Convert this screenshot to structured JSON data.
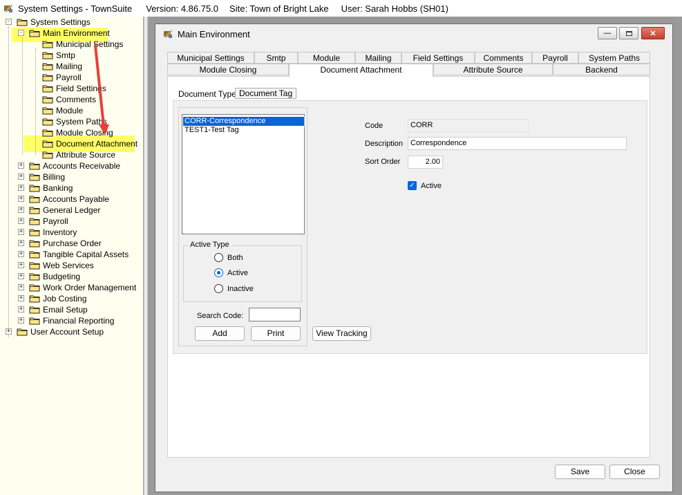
{
  "titlebar": {
    "app_title": "System Settings - TownSuite",
    "version": "Version: 4.86.75.0",
    "site": "Site: Town of Bright Lake",
    "user": "User: Sarah Hobbs (SH01)"
  },
  "tree": {
    "root": "System Settings",
    "main_env": "Main Environment",
    "children": [
      "Municipal Settings",
      "Smtp",
      "Mailing",
      "Payroll",
      "Field Settings",
      "Comments",
      "Module",
      "System Paths",
      "Module Closing",
      "Document Attachment",
      "Attribute Source"
    ],
    "modules": [
      "Accounts Receivable",
      "Billing",
      "Banking",
      "Accounts Payable",
      "General Ledger",
      "Payroll",
      "Inventory",
      "Purchase Order",
      "Tangible Capital Assets",
      "Web Services",
      "Budgeting",
      "Work Order Management",
      "Job Costing",
      "Email Setup",
      "Financial Reporting"
    ],
    "user_account": "User Account Setup"
  },
  "window": {
    "title": "Main Environment",
    "tabs_row1": [
      "Municipal Settings",
      "Smtp",
      "Module",
      "Mailing",
      "Field Settings",
      "Comments",
      "Payroll",
      "System Paths"
    ],
    "tabs_row2": [
      "Module Closing",
      "Document Attachment",
      "Attribute Source",
      "Backend"
    ],
    "subtabs": [
      "Document Type",
      "Document Tag"
    ],
    "list_items": [
      "CORR-Correspondence",
      "TEST1-Test Tag"
    ],
    "active_type": {
      "label": "Active Type",
      "options": [
        "Both",
        "Active",
        "Inactive"
      ],
      "selected": "Active"
    },
    "search_code_label": "Search Code:",
    "search_code_value": "",
    "add_label": "Add",
    "print_label": "Print",
    "view_tracking_label": "View Tracking",
    "form": {
      "code_label": "Code",
      "code_value": "CORR",
      "description_label": "Description",
      "description_value": "Correspondence",
      "sort_order_label": "Sort Order",
      "sort_order_value": "2.00",
      "active_label": "Active",
      "active_checked": true
    },
    "save_label": "Save",
    "close_label": "Close"
  },
  "colors": {
    "highlight": "#ffff66",
    "selection": "#0a64d7",
    "annotation_arrow": "#e8403a"
  }
}
